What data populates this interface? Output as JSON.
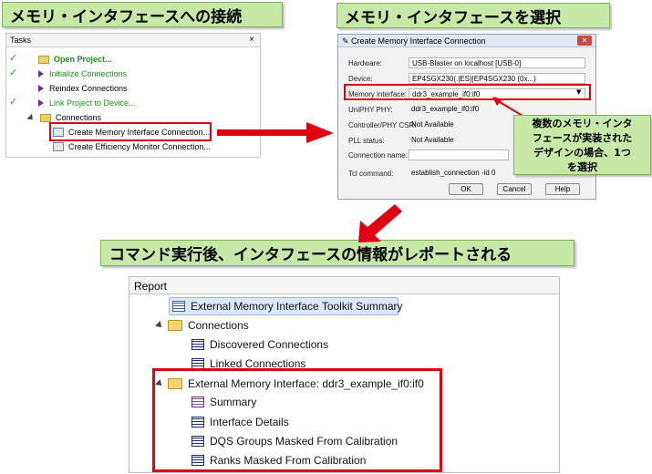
{
  "callouts": {
    "connect": "メモリ・インタフェースへの接続",
    "select": "メモリ・インタフェースを選択",
    "report": "コマンド実行後、インタフェースの情報がレポートされる",
    "note_lines": [
      "複数のメモリ・インタ",
      "フェースが実装された",
      "デザインの場合、1つ",
      "を選択"
    ]
  },
  "tasks": {
    "title": "Tasks",
    "close": "×",
    "items": [
      {
        "label": "Open Project...",
        "checked": true
      },
      {
        "label": "Initialize Connections",
        "checked": true
      },
      {
        "label": "Reindex Connections",
        "checked": false
      },
      {
        "label": "Link Project to Device...",
        "checked": true
      },
      {
        "label": "Connections",
        "checked": false
      },
      {
        "label": "Create Memory Interface Connection...",
        "checked": false
      },
      {
        "label": "Create Efficiency Monitor Connection...",
        "checked": false
      }
    ],
    "check_glyph": "✓"
  },
  "dialog": {
    "title": "Create Memory Interface Connection",
    "close": "✕",
    "fields": [
      {
        "label": "Hardware:",
        "value": "USB-Blaster on localhost [USB-0]"
      },
      {
        "label": "Device:",
        "value": "EP4SGX230(.|ES)|EP4SGX230 (0x...)"
      },
      {
        "label": "Memory interface:",
        "value": "ddr3_example_if0:if0"
      },
      {
        "label": "UniPHY PHY:",
        "value": "ddr3_example_if0:if0"
      },
      {
        "label": "Controller/PHY CSR:",
        "value": "Not Available"
      },
      {
        "label": "PLL status:",
        "value": "Not Available"
      },
      {
        "label": "Connection name:",
        "value": ""
      },
      {
        "label": "Tcl command:",
        "value": "establish_connection -id 0"
      }
    ],
    "buttons": {
      "ok": "OK",
      "cancel": "Cancel",
      "help": "Help"
    }
  },
  "report": {
    "title": "Report",
    "items": [
      {
        "label": "External Memory Interface Toolkit Summary"
      },
      {
        "label": "Connections"
      },
      {
        "label": "Discovered Connections"
      },
      {
        "label": "Linked Connections"
      },
      {
        "label": "External Memory Interface: ddr3_example_if0:if0"
      },
      {
        "label": "Summary"
      },
      {
        "label": "Interface Details"
      },
      {
        "label": "DQS Groups Masked From Calibration"
      },
      {
        "label": "Ranks Masked From Calibration"
      }
    ]
  },
  "colors": {
    "highlight": "#e0000f",
    "callout_bg": "#c6e9a7",
    "check": "#2e9c1e"
  }
}
